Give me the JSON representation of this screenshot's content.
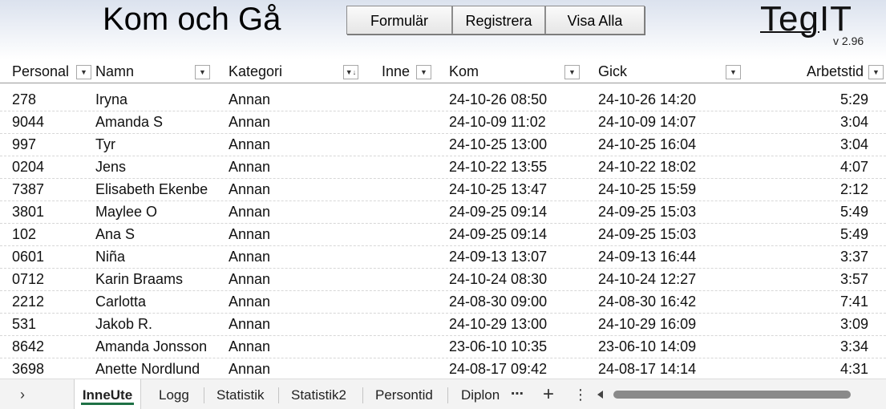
{
  "header": {
    "title": "Kom och Gå",
    "buttons": {
      "formular": "Formulär",
      "registrera": "Registrera",
      "visa_alla": "Visa Alla"
    },
    "logo_main": "Teg",
    "logo_accent": "IT",
    "version": "v 2.96"
  },
  "columns": {
    "personal": "Personal",
    "namn": "Namn",
    "kategori": "Kategori",
    "inne": "Inne",
    "kom": "Kom",
    "gick": "Gick",
    "arbetstid": "Arbetstid"
  },
  "rows": [
    {
      "personal": "278",
      "namn": "Iryna",
      "kategori": "Annan",
      "kom": "24-10-26 08:50",
      "gick": "24-10-26 14:20",
      "arbetstid": "5:29"
    },
    {
      "personal": "9044",
      "namn": "Amanda S",
      "kategori": "Annan",
      "kom": "24-10-09 11:02",
      "gick": "24-10-09 14:07",
      "arbetstid": "3:04"
    },
    {
      "personal": "997",
      "namn": "Tyr",
      "kategori": "Annan",
      "kom": "24-10-25 13:00",
      "gick": "24-10-25 16:04",
      "arbetstid": "3:04"
    },
    {
      "personal": "0204",
      "namn": "Jens",
      "kategori": "Annan",
      "kom": "24-10-22 13:55",
      "gick": "24-10-22 18:02",
      "arbetstid": "4:07"
    },
    {
      "personal": "7387",
      "namn": "Elisabeth Ekenbe",
      "kategori": "Annan",
      "kom": "24-10-25 13:47",
      "gick": "24-10-25 15:59",
      "arbetstid": "2:12"
    },
    {
      "personal": "3801",
      "namn": "Maylee O",
      "kategori": "Annan",
      "kom": "24-09-25 09:14",
      "gick": "24-09-25 15:03",
      "arbetstid": "5:49"
    },
    {
      "personal": "102",
      "namn": "Ana S",
      "kategori": "Annan",
      "kom": "24-09-25 09:14",
      "gick": "24-09-25 15:03",
      "arbetstid": "5:49"
    },
    {
      "personal": "0601",
      "namn": "Niña",
      "kategori": "Annan",
      "kom": "24-09-13 13:07",
      "gick": "24-09-13 16:44",
      "arbetstid": "3:37"
    },
    {
      "personal": "0712",
      "namn": "Karin Braams",
      "kategori": "Annan",
      "kom": "24-10-24 08:30",
      "gick": "24-10-24 12:27",
      "arbetstid": "3:57"
    },
    {
      "personal": "2212",
      "namn": "Carlotta",
      "kategori": "Annan",
      "kom": "24-08-30 09:00",
      "gick": "24-08-30 16:42",
      "arbetstid": "7:41"
    },
    {
      "personal": "531",
      "namn": "Jakob R.",
      "kategori": "Annan",
      "kom": "24-10-29 13:00",
      "gick": "24-10-29 16:09",
      "arbetstid": "3:09"
    },
    {
      "personal": "8642",
      "namn": "Amanda Jonsson",
      "kategori": "Annan",
      "kom": "23-06-10 10:35",
      "gick": "23-06-10 14:09",
      "arbetstid": "3:34"
    },
    {
      "personal": "3698",
      "namn": "Anette Nordlund",
      "kategori": "Annan",
      "kom": "24-08-17 09:42",
      "gick": "24-08-17 14:14",
      "arbetstid": "4:31"
    }
  ],
  "tabs": [
    "InneUte",
    "Logg",
    "Statistik",
    "Statistik2",
    "Persontid",
    "Diplon"
  ],
  "active_tab": "InneUte",
  "icons": {
    "nav_prev": "chevron-right-icon",
    "more_tabs": "more-horizontal-icon",
    "add_sheet": "plus-icon",
    "options": "more-vertical-icon",
    "filter": "dropdown-arrow-icon",
    "sort_filter": "sort-filter-icon"
  },
  "colors": {
    "active_tab_underline": "#1e7145",
    "banner_top": "#dbe2ee"
  }
}
